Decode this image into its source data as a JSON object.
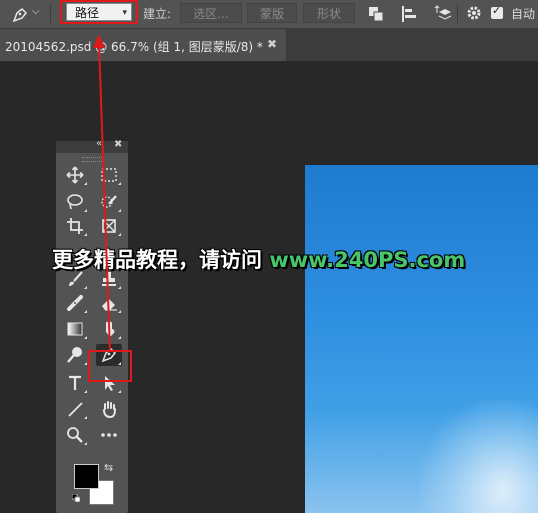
{
  "options_bar": {
    "mode_value": "路径",
    "make_label": "建立:",
    "selection_button": "选区...",
    "mask_button": "蒙版",
    "shape_button": "形状",
    "auto_label": "自动"
  },
  "document_tab": {
    "title": "20104562.psd @ 66.7% (组 1, 图层蒙版/8) *",
    "close_glyph": "✖"
  },
  "toolbox": {
    "collapse_glyph": "«",
    "close_glyph": "✖",
    "tools": [
      "move-tool",
      "marquee-tool",
      "lasso-tool",
      "quick-selection-tool",
      "crop-tool",
      "frame-tool",
      "brush-tool",
      "stamp-tool",
      "healing-tool",
      "eraser-tool",
      "gradient-tool",
      "smudge-tool",
      "dodge-tool",
      "pen-tool",
      "type-tool",
      "path-selection-tool",
      "line-tool",
      "hand-tool",
      "zoom-tool",
      "more-tools"
    ],
    "active_tool": "pen-tool",
    "swap_glyph": "⇆",
    "foreground_color": "#000000",
    "background_color": "#ffffff"
  },
  "watermark": {
    "text": "更多精品教程，请访问",
    "url": "www.240PS.com"
  },
  "annotation_color": "#e01a1a"
}
